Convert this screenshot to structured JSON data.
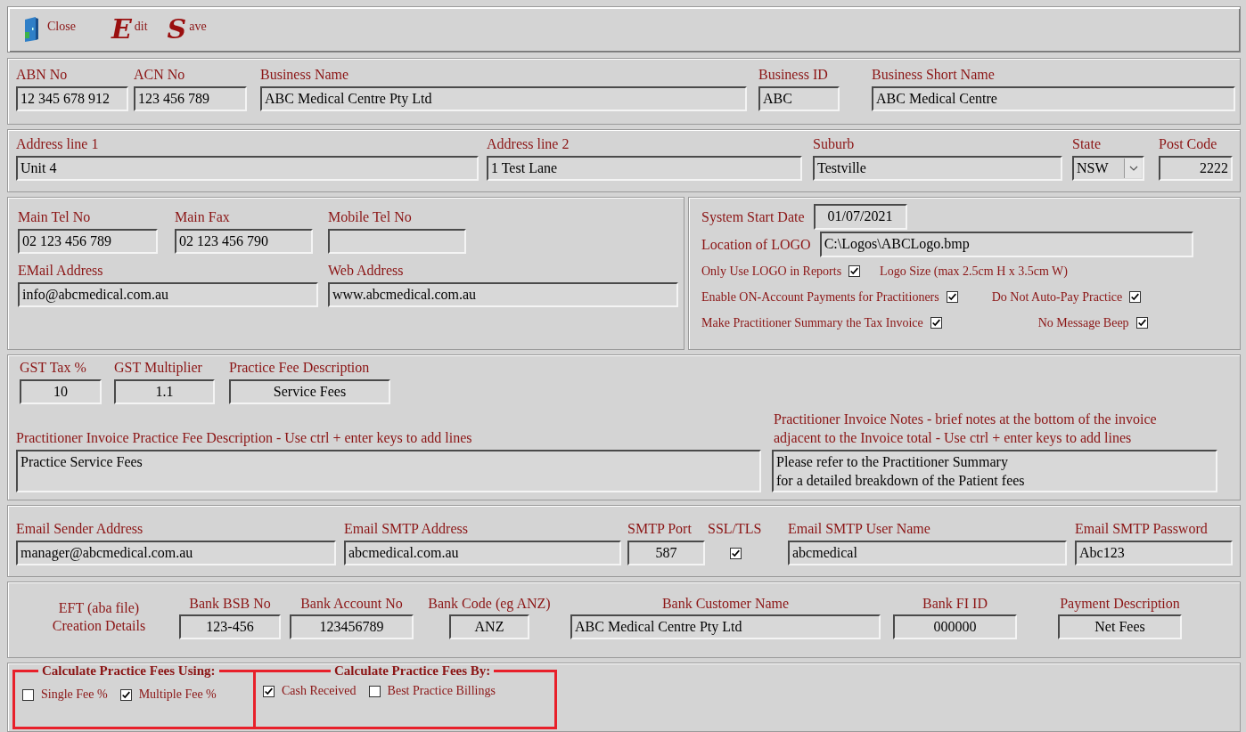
{
  "toolbar": [
    {
      "kind": "close",
      "label": "Close"
    },
    {
      "kind": "letter",
      "letter": "E",
      "label": "dit"
    },
    {
      "kind": "letter",
      "letter": "S",
      "label": "ave"
    }
  ],
  "business": {
    "fields": [
      {
        "label": "ABN No",
        "value": "12 345 678 912"
      },
      {
        "label": "ACN No",
        "value": "123 456 789"
      },
      {
        "label": "Business Name",
        "value": "ABC Medical Centre Pty Ltd"
      },
      {
        "label": "Business ID",
        "value": "ABC"
      },
      {
        "label": "Business Short Name",
        "value": "ABC Medical Centre"
      }
    ]
  },
  "address": {
    "fields": [
      {
        "kind": "text",
        "label": "Address line 1",
        "value": "Unit 4"
      },
      {
        "kind": "text",
        "label": "Address line 2",
        "value": "1 Test Lane"
      },
      {
        "kind": "text",
        "label": "Suburb",
        "value": "Testville"
      },
      {
        "kind": "select",
        "label": "State",
        "value": "NSW"
      },
      {
        "kind": "text",
        "label": "Post Code",
        "value": "2222"
      }
    ]
  },
  "contact": {
    "fields": [
      {
        "label": "Main Tel No",
        "value": "02 123 456 789"
      },
      {
        "label": "Main Fax",
        "value": "02 123 456 790"
      },
      {
        "label": "Mobile Tel No"
      },
      {
        "label": "EMail Address",
        "value": "info@abcmedical.com.au"
      },
      {
        "label": "Web Address",
        "value": "www.abcmedical.com.au"
      }
    ],
    "start_date": {
      "label": "System Start Date",
      "value": "01/07/2021"
    },
    "logo_location": {
      "label": "Location of LOGO",
      "value": "C:\\Logos\\ABCLogo.bmp"
    },
    "options": [
      {
        "label": "Only Use LOGO in Reports",
        "checked": true
      },
      {
        "label": "Enable ON-Account Payments for Practitioners",
        "checked": true
      },
      {
        "label": "Make Practitioner Summary the Tax Invoice",
        "checked": true
      }
    ],
    "logo_size_note": "Logo Size (max 2.5cm H x 3.5cm W)",
    "side_options": [
      {
        "label": "Do Not Auto-Pay Practice",
        "checked": true
      },
      {
        "label": "No Message Beep",
        "checked": true
      }
    ]
  },
  "fees": {
    "fields": [
      {
        "label": "GST Tax %",
        "value": "10"
      },
      {
        "label": "GST Multiplier",
        "value": "1.1"
      },
      {
        "label": "Practice Fee Description",
        "value": "Service Fees"
      }
    ],
    "fee_description": {
      "label": "Practitioner Invoice Practice Fee Description - Use ctrl + enter keys to add lines",
      "lines": [
        "Practice Service Fees"
      ]
    },
    "invoice_notes": {
      "label_lines": [
        "Practitioner Invoice Notes - brief notes at the bottom of the invoice",
        "adjacent to the Invoice total - Use ctrl + enter keys to add lines"
      ],
      "lines": [
        "Please refer to the Practitioner Summary",
        "for a detailed breakdown of the Patient fees"
      ]
    }
  },
  "email": {
    "fields": [
      {
        "kind": "text",
        "label": "Email Sender Address",
        "value": "manager@abcmedical.com.au"
      },
      {
        "kind": "text",
        "label": "Email SMTP Address",
        "value": "abcmedical.com.au"
      },
      {
        "kind": "text",
        "label": "SMTP Port",
        "value": "587"
      },
      {
        "kind": "checkbox",
        "label": "SSL/TLS",
        "checked": true
      },
      {
        "kind": "text",
        "label": "Email SMTP User Name",
        "value": "abcmedical"
      },
      {
        "kind": "text",
        "label": "Email SMTP Password",
        "value": "Abc123"
      }
    ]
  },
  "eft": {
    "title_lines": [
      "EFT (aba file)",
      "Creation Details"
    ],
    "fields": [
      {
        "label": "Bank BSB No",
        "value": "123-456"
      },
      {
        "label": "Bank Account No",
        "value": "123456789"
      },
      {
        "label": "Bank Code (eg ANZ)",
        "value": "ANZ"
      },
      {
        "label": "Bank Customer Name",
        "value": "ABC Medical Centre Pty Ltd"
      },
      {
        "label": "Bank FI ID",
        "value": "000000"
      },
      {
        "label": "Payment Description",
        "value": "Net Fees"
      }
    ]
  },
  "fee_options": {
    "groups": [
      {
        "title": "Calculate Practice Fees Using:",
        "options": [
          {
            "label": "Single Fee %",
            "checked": false
          },
          {
            "label": "Multiple Fee %",
            "checked": true
          }
        ]
      },
      {
        "title": "Calculate Practice Fees By:",
        "options": [
          {
            "label": "Cash Received",
            "checked": true
          },
          {
            "label": "Best Practice Billings",
            "checked": false
          }
        ]
      }
    ]
  }
}
